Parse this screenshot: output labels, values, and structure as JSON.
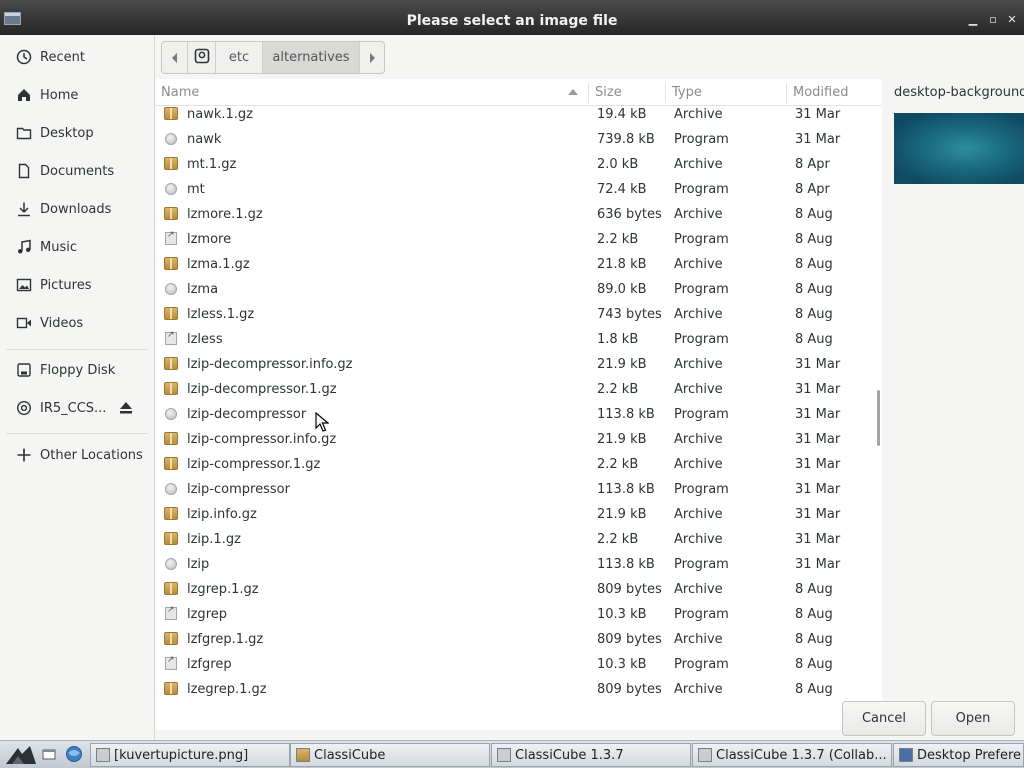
{
  "window": {
    "title": "Please select an image file"
  },
  "sidebar": {
    "items": [
      {
        "label": "Recent",
        "icon": "clock-icon"
      },
      {
        "label": "Home",
        "icon": "home-icon"
      },
      {
        "label": "Desktop",
        "icon": "folder-icon"
      },
      {
        "label": "Documents",
        "icon": "document-icon"
      },
      {
        "label": "Downloads",
        "icon": "download-icon"
      },
      {
        "label": "Music",
        "icon": "music-icon"
      },
      {
        "label": "Pictures",
        "icon": "picture-icon"
      },
      {
        "label": "Videos",
        "icon": "video-icon"
      }
    ],
    "devices": [
      {
        "label": "Floppy Disk",
        "icon": "floppy-icon"
      },
      {
        "label": "IR5_CCS...",
        "icon": "disc-icon"
      }
    ],
    "other": {
      "label": "Other Locations",
      "icon": "plus-icon"
    }
  },
  "pathbar": {
    "segments": [
      "etc",
      "alternatives"
    ],
    "active": "alternatives"
  },
  "list": {
    "columns": {
      "name": "Name",
      "size": "Size",
      "type": "Type",
      "modified": "Modified"
    },
    "rows": [
      {
        "name": "nawk.1.gz",
        "size": "19.4 kB",
        "type": "Archive",
        "modified": "31 Mar",
        "icon": "archive"
      },
      {
        "name": "nawk",
        "size": "739.8 kB",
        "type": "Program",
        "modified": "31 Mar",
        "icon": "program"
      },
      {
        "name": "mt.1.gz",
        "size": "2.0 kB",
        "type": "Archive",
        "modified": "8 Apr",
        "icon": "archive"
      },
      {
        "name": "mt",
        "size": "72.4 kB",
        "type": "Program",
        "modified": "8 Apr",
        "icon": "program"
      },
      {
        "name": "lzmore.1.gz",
        "size": "636 bytes",
        "type": "Archive",
        "modified": "8 Aug",
        "icon": "archive"
      },
      {
        "name": "lzmore",
        "size": "2.2 kB",
        "type": "Program",
        "modified": "8 Aug",
        "icon": "script"
      },
      {
        "name": "lzma.1.gz",
        "size": "21.8 kB",
        "type": "Archive",
        "modified": "8 Aug",
        "icon": "archive"
      },
      {
        "name": "lzma",
        "size": "89.0 kB",
        "type": "Program",
        "modified": "8 Aug",
        "icon": "program"
      },
      {
        "name": "lzless.1.gz",
        "size": "743 bytes",
        "type": "Archive",
        "modified": "8 Aug",
        "icon": "archive"
      },
      {
        "name": "lzless",
        "size": "1.8 kB",
        "type": "Program",
        "modified": "8 Aug",
        "icon": "script"
      },
      {
        "name": "lzip-decompressor.info.gz",
        "size": "21.9 kB",
        "type": "Archive",
        "modified": "31 Mar",
        "icon": "archive"
      },
      {
        "name": "lzip-decompressor.1.gz",
        "size": "2.2 kB",
        "type": "Archive",
        "modified": "31 Mar",
        "icon": "archive"
      },
      {
        "name": "lzip-decompressor",
        "size": "113.8 kB",
        "type": "Program",
        "modified": "31 Mar",
        "icon": "program"
      },
      {
        "name": "lzip-compressor.info.gz",
        "size": "21.9 kB",
        "type": "Archive",
        "modified": "31 Mar",
        "icon": "archive"
      },
      {
        "name": "lzip-compressor.1.gz",
        "size": "2.2 kB",
        "type": "Archive",
        "modified": "31 Mar",
        "icon": "archive"
      },
      {
        "name": "lzip-compressor",
        "size": "113.8 kB",
        "type": "Program",
        "modified": "31 Mar",
        "icon": "program"
      },
      {
        "name": "lzip.info.gz",
        "size": "21.9 kB",
        "type": "Archive",
        "modified": "31 Mar",
        "icon": "archive"
      },
      {
        "name": "lzip.1.gz",
        "size": "2.2 kB",
        "type": "Archive",
        "modified": "31 Mar",
        "icon": "archive"
      },
      {
        "name": "lzip",
        "size": "113.8 kB",
        "type": "Program",
        "modified": "31 Mar",
        "icon": "program"
      },
      {
        "name": "lzgrep.1.gz",
        "size": "809 bytes",
        "type": "Archive",
        "modified": "8 Aug",
        "icon": "archive"
      },
      {
        "name": "lzgrep",
        "size": "10.3 kB",
        "type": "Program",
        "modified": "8 Aug",
        "icon": "script"
      },
      {
        "name": "lzfgrep.1.gz",
        "size": "809 bytes",
        "type": "Archive",
        "modified": "8 Aug",
        "icon": "archive"
      },
      {
        "name": "lzfgrep",
        "size": "10.3 kB",
        "type": "Program",
        "modified": "8 Aug",
        "icon": "script"
      },
      {
        "name": "lzegrep.1.gz",
        "size": "809 bytes",
        "type": "Archive",
        "modified": "8 Aug",
        "icon": "archive"
      }
    ]
  },
  "preview": {
    "filename": "desktop-background"
  },
  "buttons": {
    "cancel": "Cancel",
    "open": "Open"
  },
  "taskbar": {
    "tasks": [
      {
        "label": "[kuvertupicture.png]"
      },
      {
        "label": "ClassiCube"
      },
      {
        "label": "ClassiCube 1.3.7"
      },
      {
        "label": "ClassiCube 1.3.7 (Collab..."
      },
      {
        "label": "Desktop Prefere"
      }
    ]
  },
  "colors": {
    "accent": "#d9d9d7",
    "titlebar": "#333333",
    "background": "#f5f5f4"
  }
}
